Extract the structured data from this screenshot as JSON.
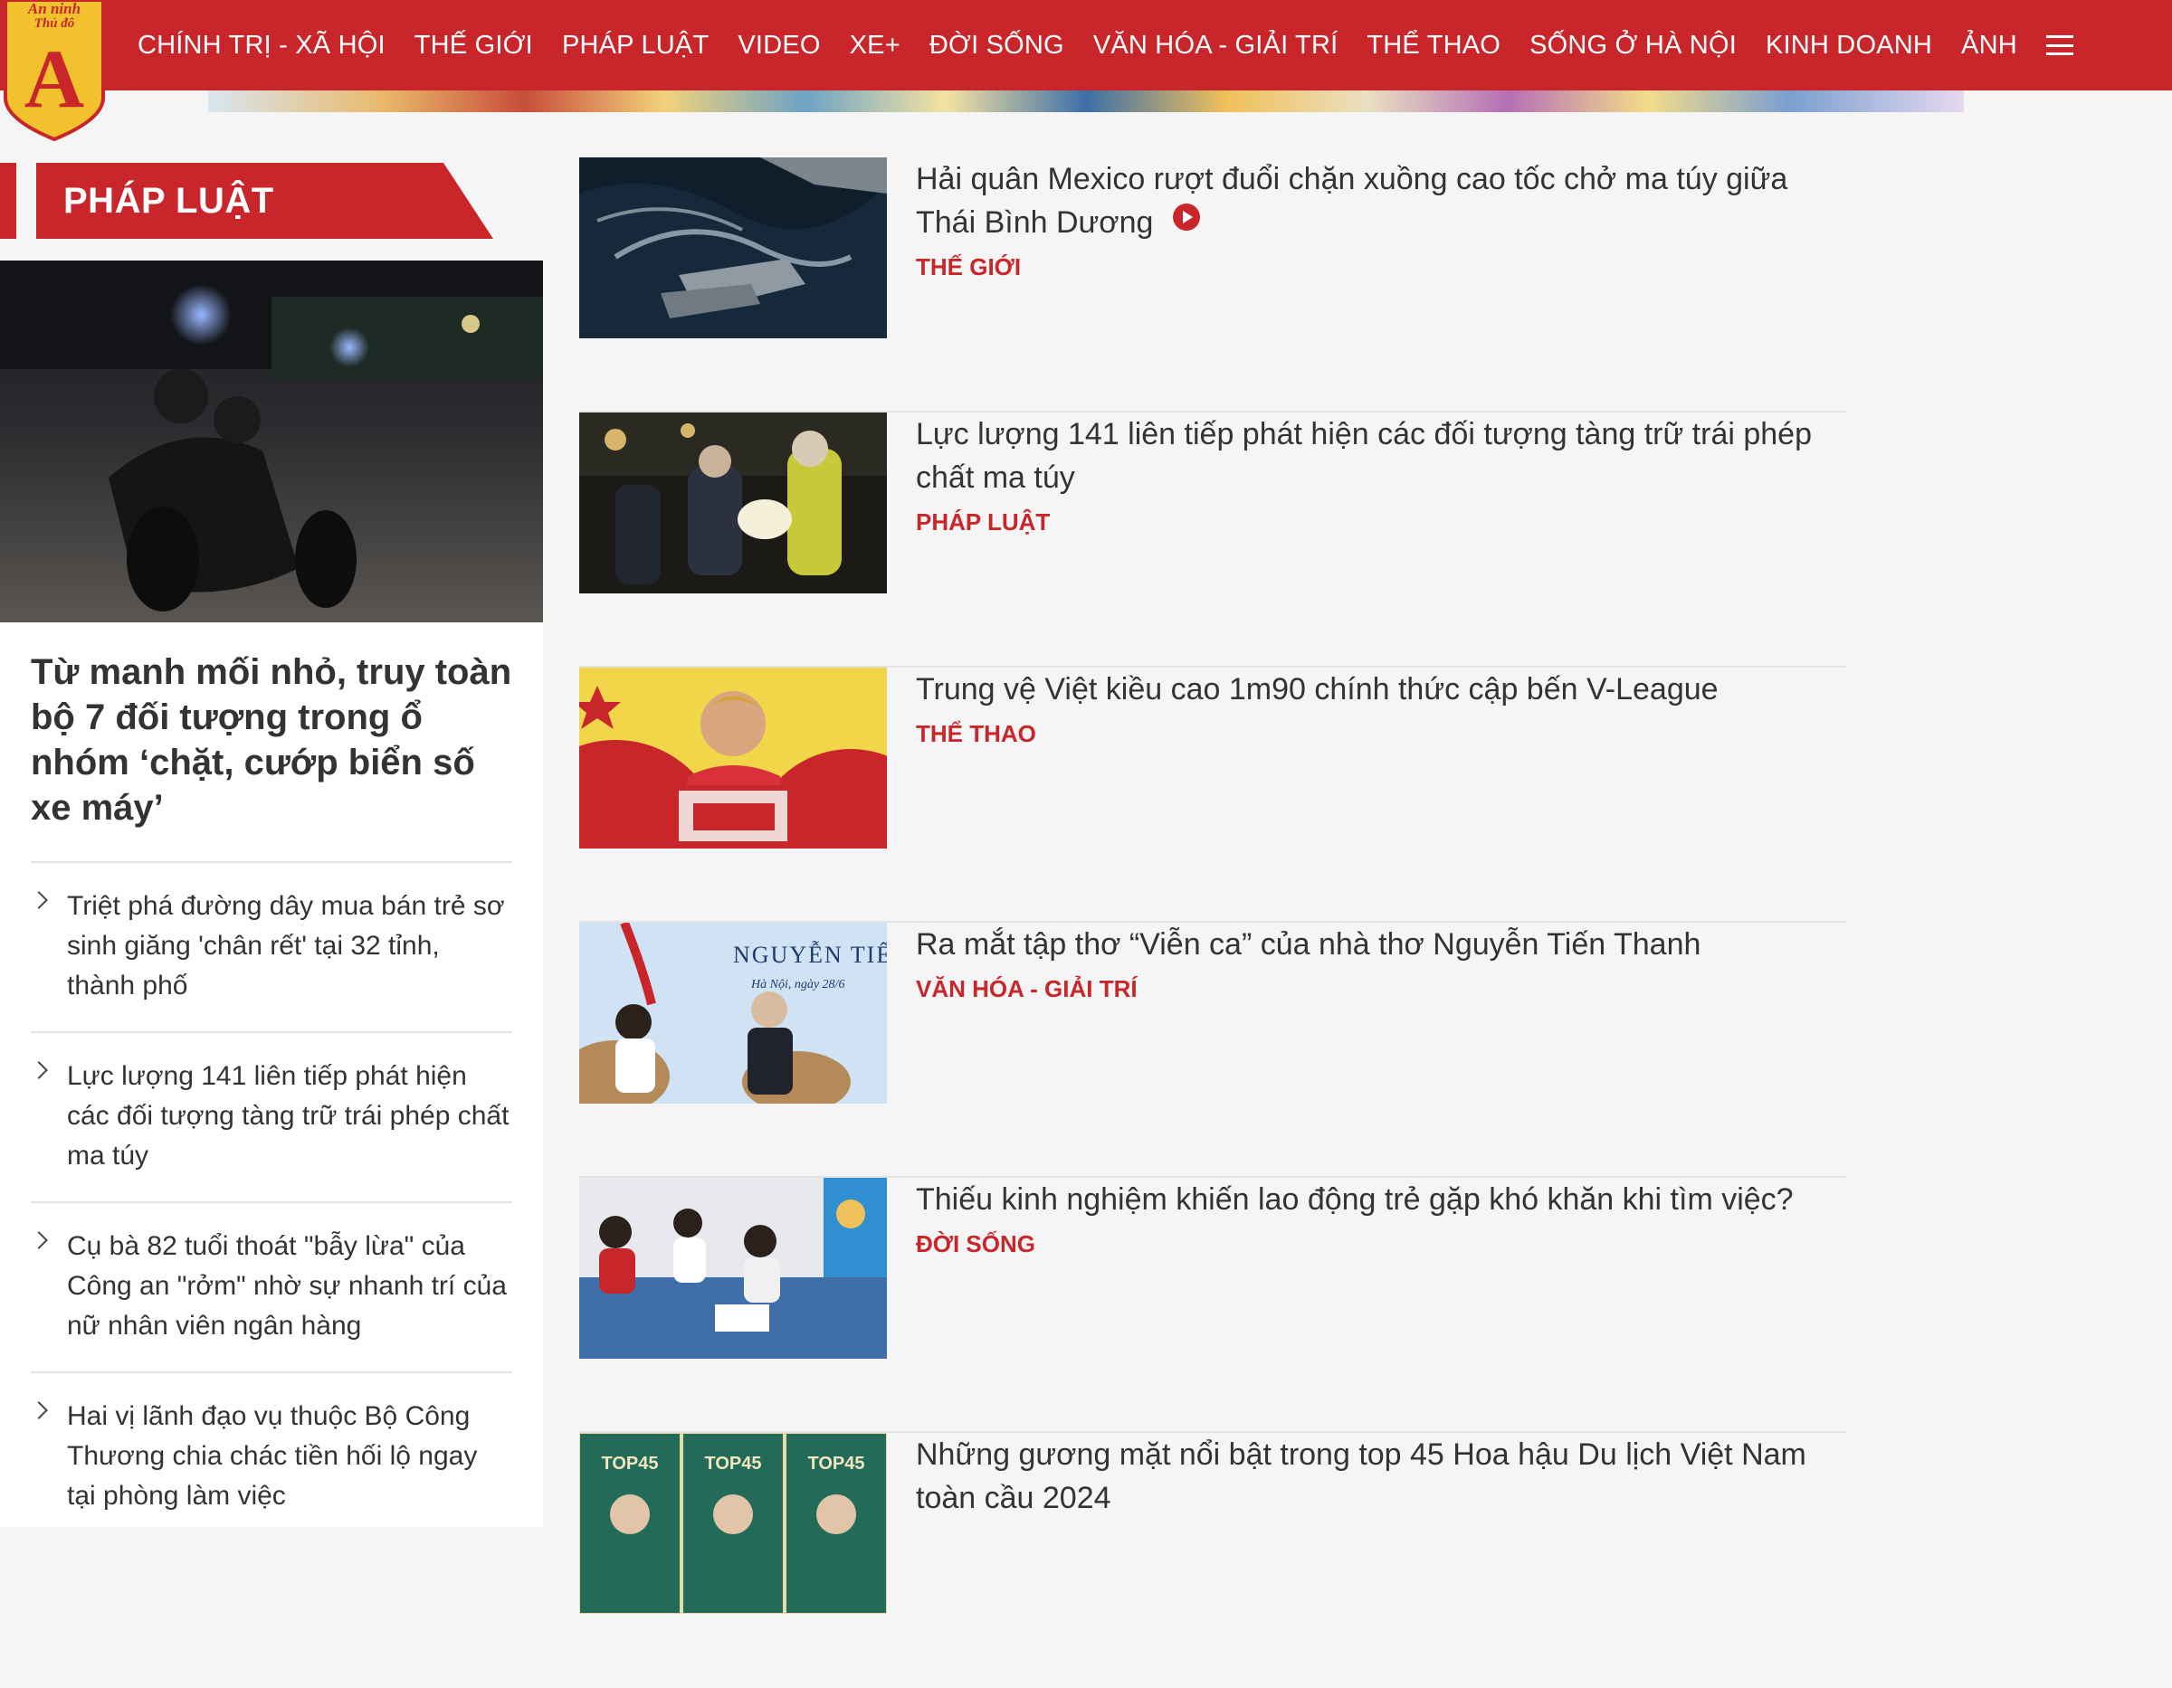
{
  "brand": {
    "logo_text_top": "An ninh Thủ đô",
    "logo_letter": "A",
    "primary_color": "#c8262b"
  },
  "nav": {
    "items": [
      "CHÍNH TRỊ - XÃ HỘI",
      "THẾ GIỚI",
      "PHÁP LUẬT",
      "VIDEO",
      "XE+",
      "ĐỜI SỐNG",
      "VĂN HÓA - GIẢI TRÍ",
      "THỂ THAO",
      "SỐNG Ở HÀ NỘI",
      "KINH DOANH",
      "ẢNH"
    ],
    "menu_icon": "hamburger-menu-icon"
  },
  "section": {
    "title": "PHÁP LUẬT"
  },
  "feature": {
    "title": "Từ manh mối nhỏ, truy toàn bộ 7 đối tượng trong ổ nhóm ‘chặt, cướp biển số xe máy’",
    "related": [
      "Triệt phá đường dây mua bán trẻ sơ sinh giăng 'chân rết' tại 32 tỉnh, thành phố",
      "Lực lượng 141 liên tiếp phát hiện các đối tượng tàng trữ trái phép chất ma túy",
      "Cụ bà 82 tuổi thoát \"bẫy lừa\" của Công an \"rởm\" nhờ sự nhanh trí của nữ nhân viên ngân hàng",
      "Hai vị lãnh đạo vụ thuộc Bộ Công Thương chia chác tiền hối lộ ngay tại phòng làm việc"
    ]
  },
  "articles": [
    {
      "title": "Hải quân Mexico rượt đuổi chặn xuồng cao tốc chở ma túy giữa Thái Bình Dương",
      "category": "THẾ GIỚI",
      "has_video": true
    },
    {
      "title": "Lực lượng 141 liên tiếp phát hiện các đối tượng tàng trữ trái phép chất ma túy",
      "category": "PHÁP LUẬT",
      "has_video": false
    },
    {
      "title": "Trung vệ Việt kiều cao 1m90 chính thức cập bến V-League",
      "category": "THỂ THAO",
      "has_video": false
    },
    {
      "title": "Ra mắt tập thơ “Viễn ca” của nhà thơ Nguyễn Tiến Thanh",
      "category": "VĂN HÓA - GIẢI TRÍ",
      "has_video": false
    },
    {
      "title": "Thiếu kinh nghiệm khiến lao động trẻ gặp khó khăn khi tìm việc?",
      "category": "ĐỜI SỐNG",
      "has_video": false
    },
    {
      "title": "Những gương mặt nổi bật trong top 45 Hoa hậu Du lịch Việt Nam toàn cầu 2024",
      "category": "",
      "has_video": false
    }
  ],
  "thumb_text": {
    "poet_name": "NGUYỄN TIẾN T",
    "poet_sub": "Hà Nội, ngày 28/6",
    "top45": "TOP45"
  }
}
